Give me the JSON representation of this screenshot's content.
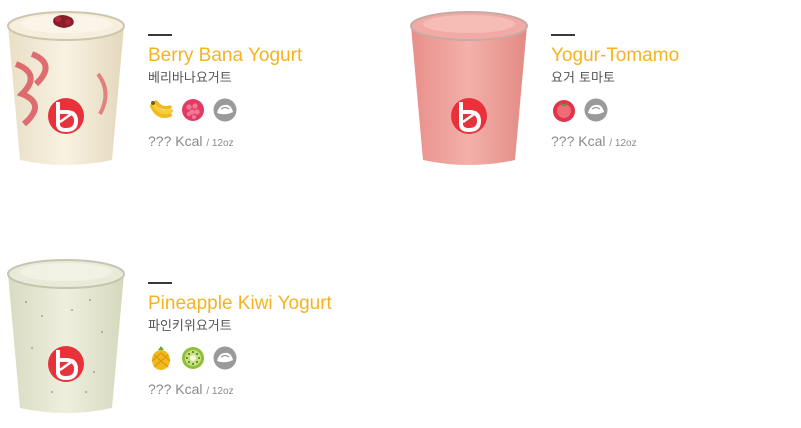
{
  "products": [
    {
      "name_en": "Berry Bana Yogurt",
      "name_ko": "베리바나요거트",
      "kcal_value": "???",
      "kcal_unit": "Kcal",
      "size": "/ 12oz",
      "ingredient_icons": [
        "banana-icon",
        "raspberry-icon",
        "yogurt-icon"
      ],
      "drink_color": "#f4ecd8",
      "swirl_color": "#d8414d"
    },
    {
      "name_en": "Yogur-Tomamo",
      "name_ko": "요거 토마토",
      "kcal_value": "???",
      "kcal_unit": "Kcal",
      "size": "/ 12oz",
      "ingredient_icons": [
        "tomato-icon",
        "yogurt-icon"
      ],
      "drink_color": "#ef9f9a"
    },
    {
      "name_en": "Pineapple Kiwi Yogurt",
      "name_ko": "파인키위요거트",
      "kcal_value": "???",
      "kcal_unit": "Kcal",
      "size": "/ 12oz",
      "ingredient_icons": [
        "pineapple-icon",
        "kiwi-icon",
        "yogurt-icon"
      ],
      "drink_color": "#e6e8d2"
    }
  ],
  "colors": {
    "title": "#f5b320",
    "logo_red": "#e8323b",
    "kcal_text": "#8a8a8a"
  }
}
